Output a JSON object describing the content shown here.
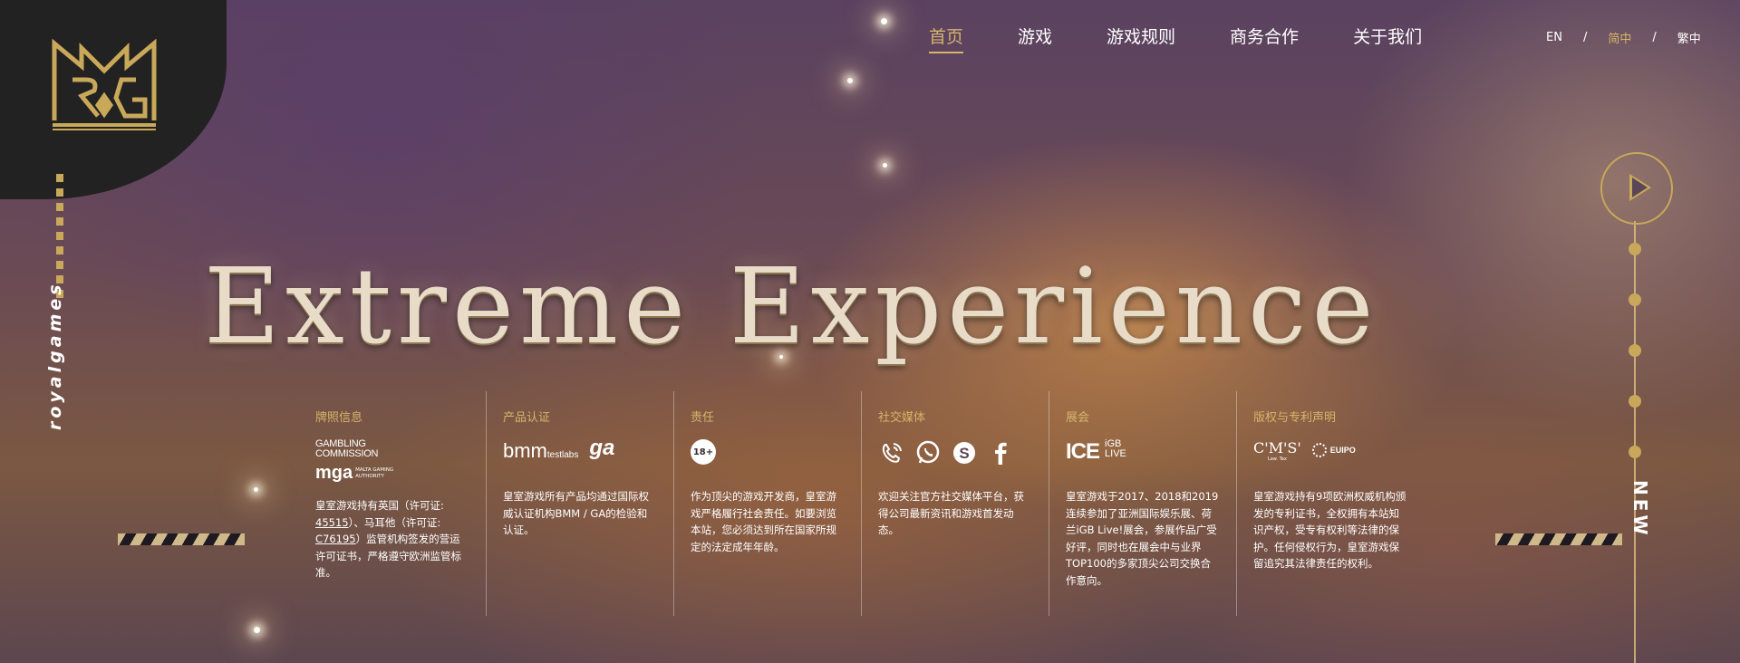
{
  "brand": {
    "name": "royalgames"
  },
  "nav": {
    "items": [
      {
        "label": "首页",
        "active": true
      },
      {
        "label": "游戏",
        "active": false
      },
      {
        "label": "游戏规则",
        "active": false
      },
      {
        "label": "商务合作",
        "active": false
      },
      {
        "label": "关于我们",
        "active": false
      }
    ]
  },
  "lang": {
    "en": "EN",
    "sep": "/",
    "zh_cn": "简中",
    "zh_tw": "繁中",
    "active": "简中"
  },
  "hero": {
    "headline": "Extreme Experience"
  },
  "side": {
    "new_label": "NEW"
  },
  "colors": {
    "accent": "#d6b46a",
    "logo_bg": "#222222"
  },
  "info": {
    "license": {
      "title": "牌照信息",
      "logos": {
        "gc_line1": "GAMBLING",
        "gc_line2": "COMMISSION",
        "mga": "mga",
        "mga_sub1": "MALTA GAMING",
        "mga_sub2": "AUTHORITY"
      },
      "text_1": "皇室游戏持有英国（许可证:",
      "link_1": "45515",
      "text_2": "）、马耳他（许可证:",
      "link_2": "C76195",
      "text_3": "）监管机构签发的营运许可证书，严格遵守欧洲监管标准。"
    },
    "cert": {
      "title": "产品认证",
      "logos": {
        "bmm": "bmm",
        "testlabs": "testlabs",
        "ga": "ga"
      },
      "text": "皇室游戏所有产品均通过国际权威认证机构BMM / GA的检验和认证。"
    },
    "responsibility": {
      "title": "责任",
      "badge": "18+",
      "text": "作为顶尖的游戏开发商，皇室游戏严格履行社会责任。如要浏览本站，您必须达到所在国家所规定的法定成年年龄。"
    },
    "social": {
      "title": "社交媒体",
      "icons": [
        "viber-icon",
        "whatsapp-icon",
        "skype-icon",
        "facebook-icon"
      ],
      "text": "欢迎关注官方社交媒体平台，获得公司最新资讯和游戏首发动态。"
    },
    "expo": {
      "title": "展会",
      "logos": {
        "ice": "ICE",
        "igb_1": "iGB",
        "igb_2": "LIVE"
      },
      "text": "皇室游戏于2017、2018和2019连续参加了亚洲国际娱乐展、荷兰iGB Live!展会，参展作品广受好评，同时也在展会中与业界TOP100的多家顶尖公司交换合作意向。"
    },
    "copyright": {
      "title": "版权与专利声明",
      "logos": {
        "cms": "C'M'S'",
        "cms_sub": "Law. Tax",
        "euipo": "EUIPO"
      },
      "text": "皇室游戏持有9项欧洲权威机构颁发的专利证书，全权拥有本站知识产权，受专有权利等法律的保护。任何侵权行为，皇室游戏保留追究其法律责任的权利。"
    }
  }
}
